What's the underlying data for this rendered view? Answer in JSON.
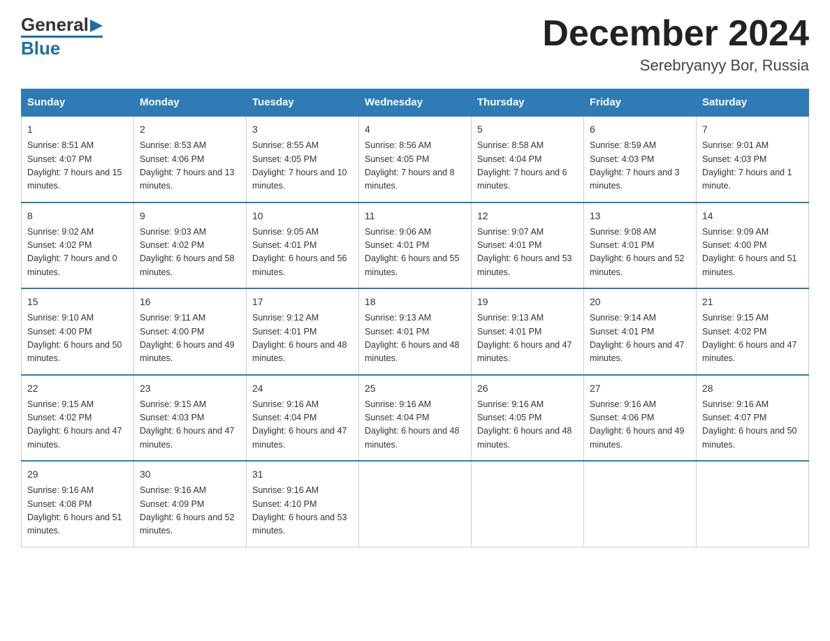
{
  "header": {
    "logo_general": "General",
    "logo_blue": "Blue",
    "month_title": "December 2024",
    "location": "Serebryanyy Bor, Russia"
  },
  "days_of_week": [
    "Sunday",
    "Monday",
    "Tuesday",
    "Wednesday",
    "Thursday",
    "Friday",
    "Saturday"
  ],
  "weeks": [
    [
      {
        "num": "1",
        "sunrise": "8:51 AM",
        "sunset": "4:07 PM",
        "daylight": "7 hours and 15 minutes."
      },
      {
        "num": "2",
        "sunrise": "8:53 AM",
        "sunset": "4:06 PM",
        "daylight": "7 hours and 13 minutes."
      },
      {
        "num": "3",
        "sunrise": "8:55 AM",
        "sunset": "4:05 PM",
        "daylight": "7 hours and 10 minutes."
      },
      {
        "num": "4",
        "sunrise": "8:56 AM",
        "sunset": "4:05 PM",
        "daylight": "7 hours and 8 minutes."
      },
      {
        "num": "5",
        "sunrise": "8:58 AM",
        "sunset": "4:04 PM",
        "daylight": "7 hours and 6 minutes."
      },
      {
        "num": "6",
        "sunrise": "8:59 AM",
        "sunset": "4:03 PM",
        "daylight": "7 hours and 3 minutes."
      },
      {
        "num": "7",
        "sunrise": "9:01 AM",
        "sunset": "4:03 PM",
        "daylight": "7 hours and 1 minute."
      }
    ],
    [
      {
        "num": "8",
        "sunrise": "9:02 AM",
        "sunset": "4:02 PM",
        "daylight": "7 hours and 0 minutes."
      },
      {
        "num": "9",
        "sunrise": "9:03 AM",
        "sunset": "4:02 PM",
        "daylight": "6 hours and 58 minutes."
      },
      {
        "num": "10",
        "sunrise": "9:05 AM",
        "sunset": "4:01 PM",
        "daylight": "6 hours and 56 minutes."
      },
      {
        "num": "11",
        "sunrise": "9:06 AM",
        "sunset": "4:01 PM",
        "daylight": "6 hours and 55 minutes."
      },
      {
        "num": "12",
        "sunrise": "9:07 AM",
        "sunset": "4:01 PM",
        "daylight": "6 hours and 53 minutes."
      },
      {
        "num": "13",
        "sunrise": "9:08 AM",
        "sunset": "4:01 PM",
        "daylight": "6 hours and 52 minutes."
      },
      {
        "num": "14",
        "sunrise": "9:09 AM",
        "sunset": "4:00 PM",
        "daylight": "6 hours and 51 minutes."
      }
    ],
    [
      {
        "num": "15",
        "sunrise": "9:10 AM",
        "sunset": "4:00 PM",
        "daylight": "6 hours and 50 minutes."
      },
      {
        "num": "16",
        "sunrise": "9:11 AM",
        "sunset": "4:00 PM",
        "daylight": "6 hours and 49 minutes."
      },
      {
        "num": "17",
        "sunrise": "9:12 AM",
        "sunset": "4:01 PM",
        "daylight": "6 hours and 48 minutes."
      },
      {
        "num": "18",
        "sunrise": "9:13 AM",
        "sunset": "4:01 PM",
        "daylight": "6 hours and 48 minutes."
      },
      {
        "num": "19",
        "sunrise": "9:13 AM",
        "sunset": "4:01 PM",
        "daylight": "6 hours and 47 minutes."
      },
      {
        "num": "20",
        "sunrise": "9:14 AM",
        "sunset": "4:01 PM",
        "daylight": "6 hours and 47 minutes."
      },
      {
        "num": "21",
        "sunrise": "9:15 AM",
        "sunset": "4:02 PM",
        "daylight": "6 hours and 47 minutes."
      }
    ],
    [
      {
        "num": "22",
        "sunrise": "9:15 AM",
        "sunset": "4:02 PM",
        "daylight": "6 hours and 47 minutes."
      },
      {
        "num": "23",
        "sunrise": "9:15 AM",
        "sunset": "4:03 PM",
        "daylight": "6 hours and 47 minutes."
      },
      {
        "num": "24",
        "sunrise": "9:16 AM",
        "sunset": "4:04 PM",
        "daylight": "6 hours and 47 minutes."
      },
      {
        "num": "25",
        "sunrise": "9:16 AM",
        "sunset": "4:04 PM",
        "daylight": "6 hours and 48 minutes."
      },
      {
        "num": "26",
        "sunrise": "9:16 AM",
        "sunset": "4:05 PM",
        "daylight": "6 hours and 48 minutes."
      },
      {
        "num": "27",
        "sunrise": "9:16 AM",
        "sunset": "4:06 PM",
        "daylight": "6 hours and 49 minutes."
      },
      {
        "num": "28",
        "sunrise": "9:16 AM",
        "sunset": "4:07 PM",
        "daylight": "6 hours and 50 minutes."
      }
    ],
    [
      {
        "num": "29",
        "sunrise": "9:16 AM",
        "sunset": "4:08 PM",
        "daylight": "6 hours and 51 minutes."
      },
      {
        "num": "30",
        "sunrise": "9:16 AM",
        "sunset": "4:09 PM",
        "daylight": "6 hours and 52 minutes."
      },
      {
        "num": "31",
        "sunrise": "9:16 AM",
        "sunset": "4:10 PM",
        "daylight": "6 hours and 53 minutes."
      },
      null,
      null,
      null,
      null
    ]
  ],
  "labels": {
    "sunrise": "Sunrise:",
    "sunset": "Sunset:",
    "daylight": "Daylight:"
  }
}
